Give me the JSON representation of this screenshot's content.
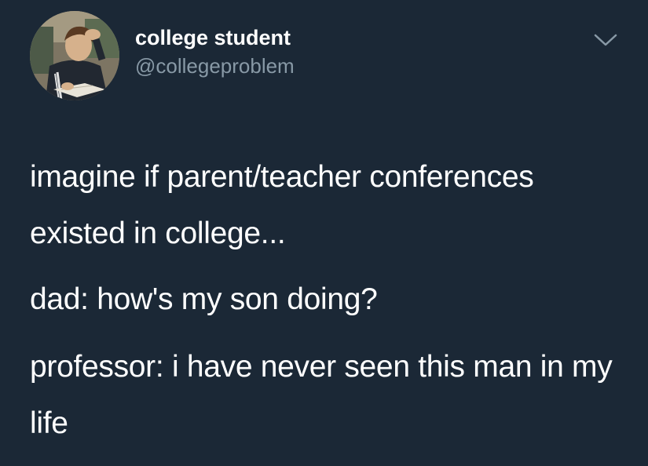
{
  "tweet": {
    "author": {
      "display_name": "college student",
      "handle": "@collegeproblem",
      "avatar_icon": "profile-photo-student-studying"
    },
    "menu_icon": "chevron-down-icon",
    "paragraphs": [
      "imagine if parent/teacher conferences existed in college...",
      "dad: how's my son doing?",
      "professor: i have never seen this man in my life"
    ]
  },
  "colors": {
    "background": "#1b2836",
    "text": "#ffffff",
    "secondary_text": "#8899a6"
  }
}
